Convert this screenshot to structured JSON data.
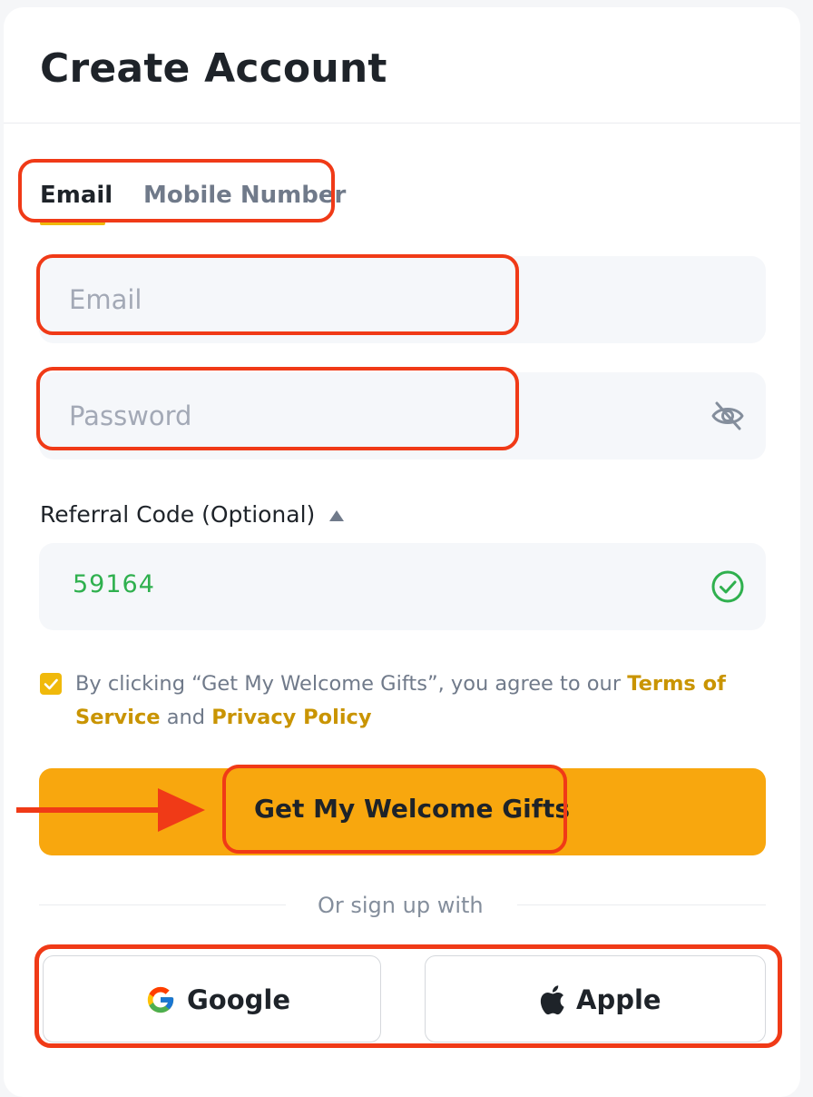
{
  "header": {
    "title": "Create Account"
  },
  "tabs": [
    {
      "label": "Email",
      "active": true
    },
    {
      "label": "Mobile Number",
      "active": false
    }
  ],
  "form": {
    "email": {
      "placeholder": "Email",
      "value": ""
    },
    "password": {
      "placeholder": "Password",
      "value": "",
      "toggle_icon": "eye-slash-icon"
    },
    "referral": {
      "label": "Referral Code (Optional)",
      "value": "59164",
      "status_icon": "check-circle-icon"
    }
  },
  "terms": {
    "checked": true,
    "prefix": "By clicking “Get My Welcome Gifts”, you agree to our ",
    "terms_link": "Terms of Service",
    "middle": " and ",
    "privacy_link": "Privacy Policy"
  },
  "submit": {
    "label": "Get My Welcome Gifts"
  },
  "social": {
    "divider_text": "Or sign up with",
    "google_label": "Google",
    "apple_label": "Apple"
  },
  "colors": {
    "accent": "#f8a70e",
    "brand_yellow": "#f0b90b",
    "link": "#c99400",
    "success": "#2fb04e",
    "annotation": "#f03a17"
  }
}
